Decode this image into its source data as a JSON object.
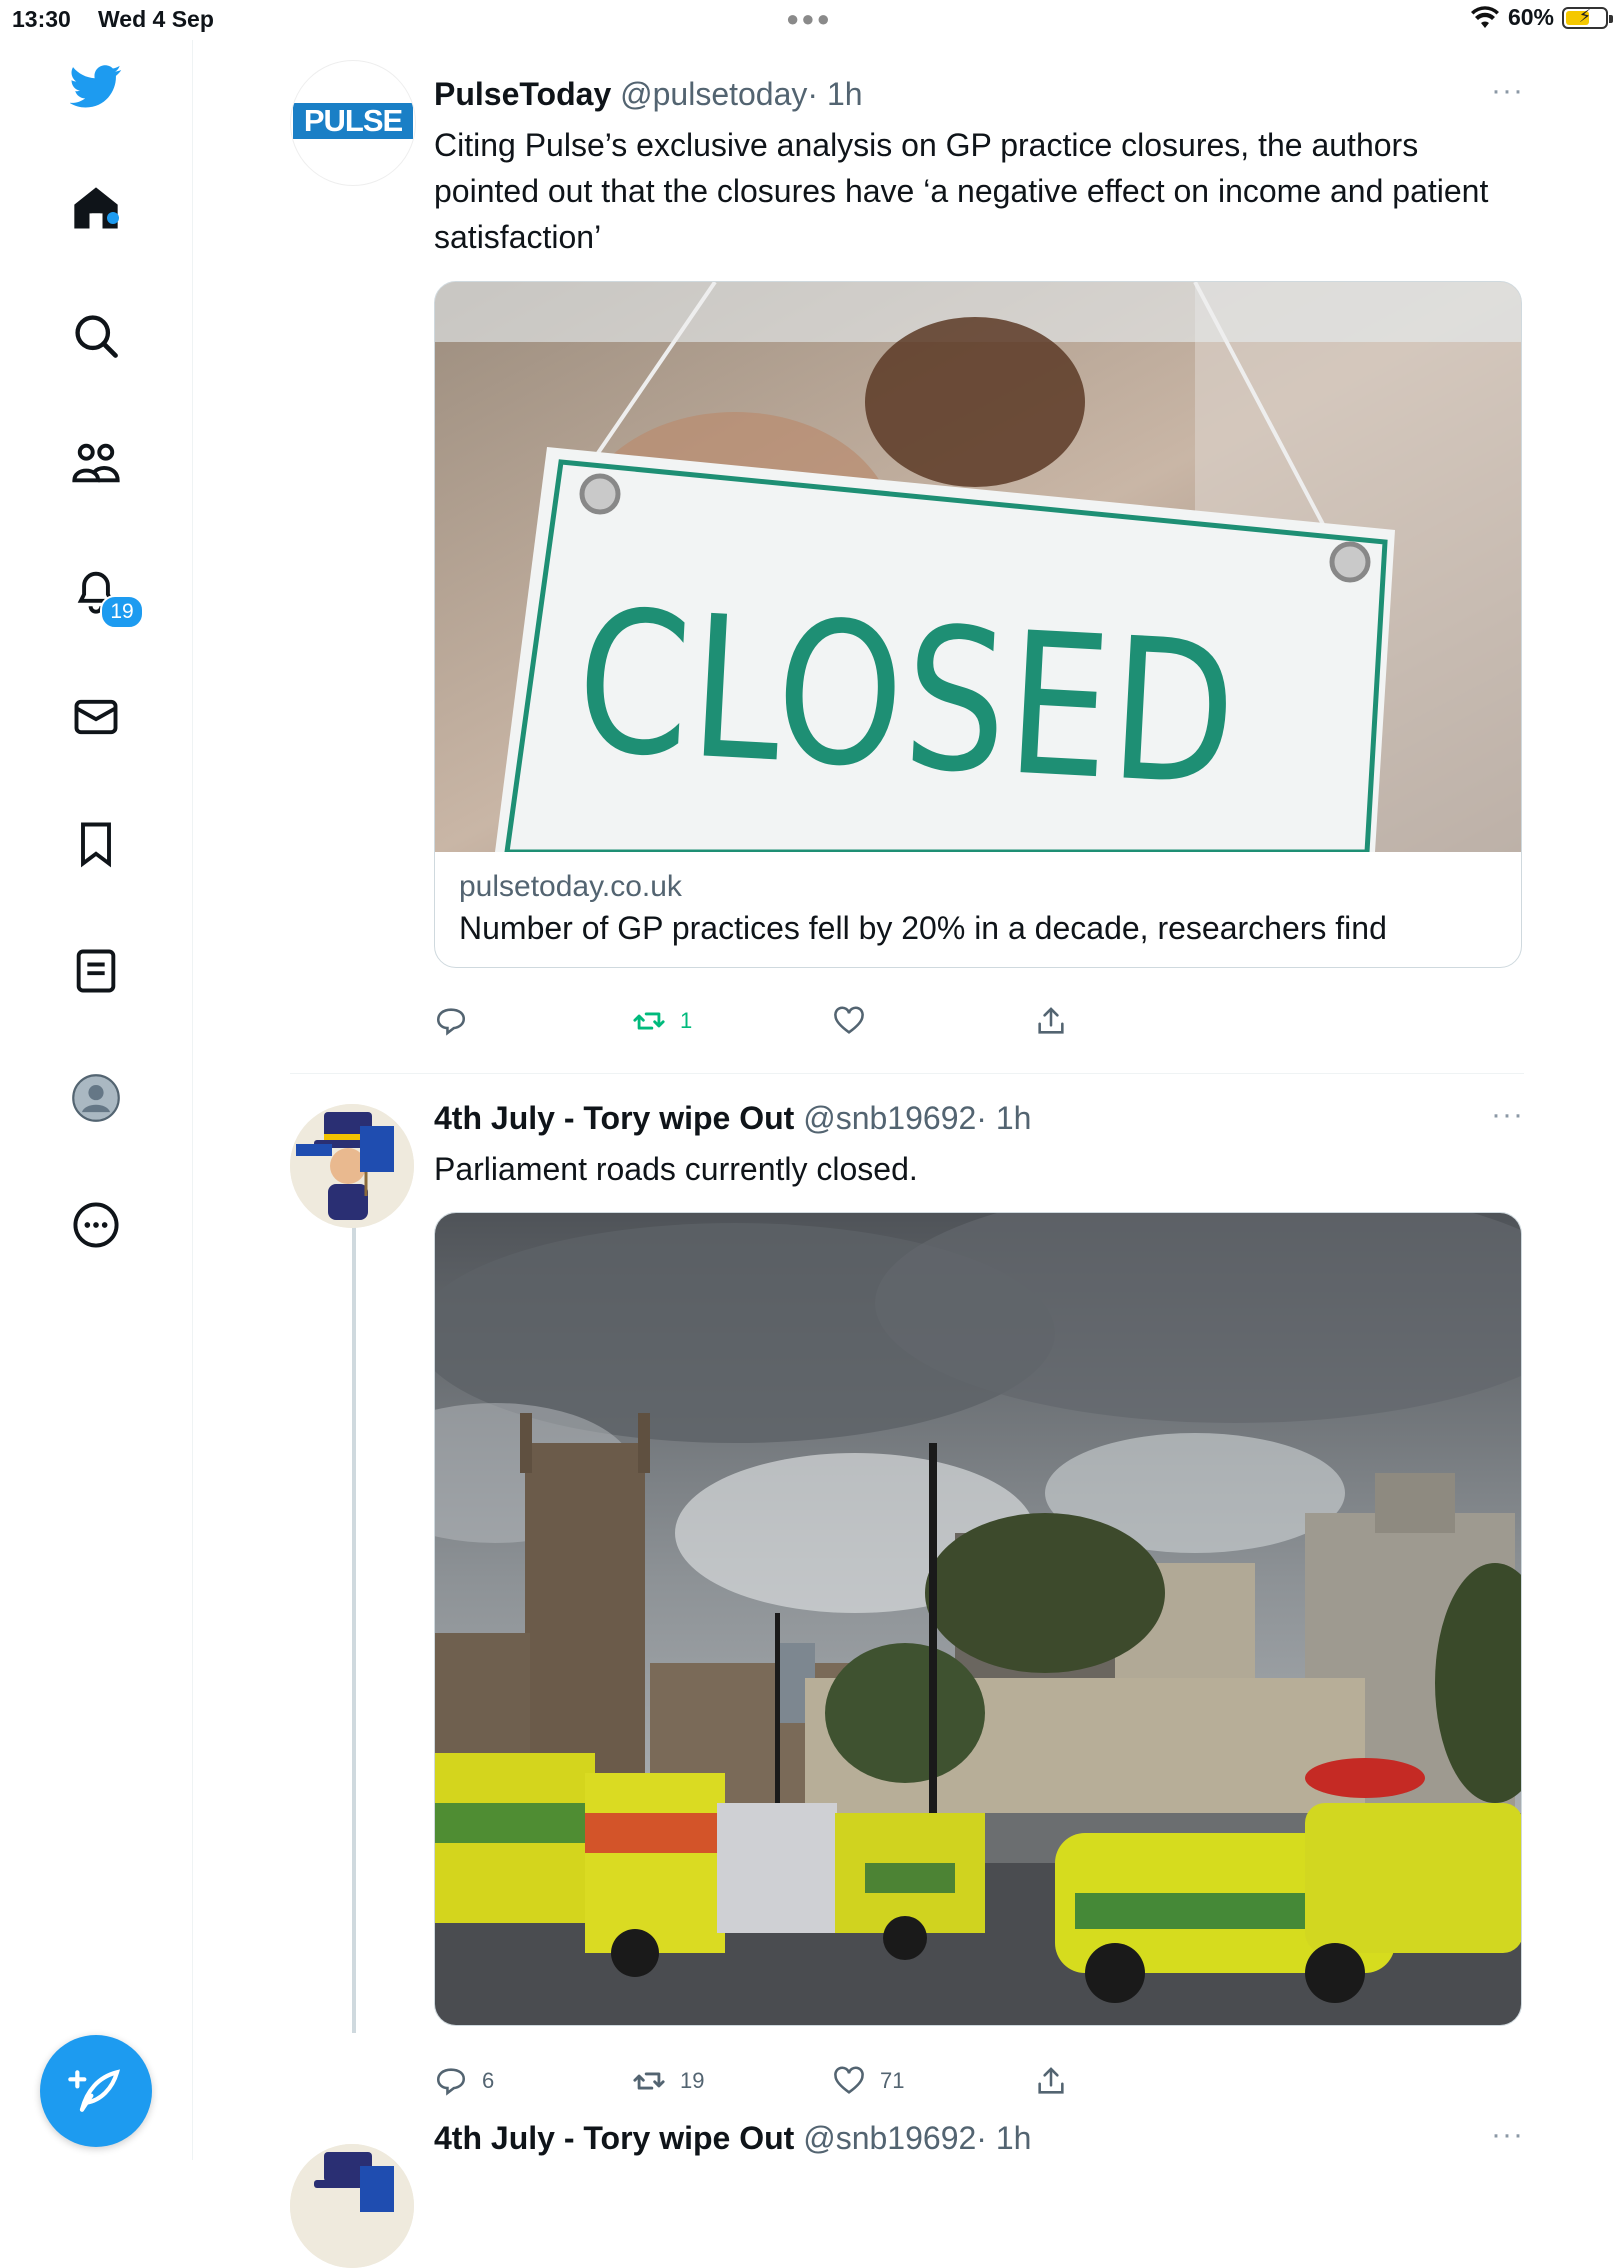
{
  "status_bar": {
    "time": "13:30",
    "date": "Wed 4 Sep",
    "battery": "60%",
    "battery_level": 0.6
  },
  "sidebar": {
    "items": [
      {
        "icon": "twitter-logo-icon"
      },
      {
        "icon": "home-icon"
      },
      {
        "icon": "search-icon"
      },
      {
        "icon": "communities-icon"
      },
      {
        "icon": "notifications-bell-icon",
        "badge": "19"
      },
      {
        "icon": "messages-envelope-icon"
      },
      {
        "icon": "bookmark-icon"
      },
      {
        "icon": "lists-icon"
      },
      {
        "icon": "profile-avatar-icon"
      },
      {
        "icon": "more-circle-icon"
      }
    ],
    "compose_icon": "compose-feather-icon"
  },
  "colors": {
    "accent": "#1d9bf0",
    "retweet_active": "#00ba7c",
    "secondary_text": "#536471"
  },
  "tweets": [
    {
      "name": "PulseToday",
      "handle": "@pulsetoday",
      "time": "· 1h",
      "more": "···",
      "avatar_logo": "PULSE",
      "text": "Citing Pulse’s exclusive analysis on GP practice closures, the authors pointed out that the closures have ‘a negative effect on income and patient satisfaction’",
      "media_sign_text": "CLOSED",
      "card": {
        "domain": "pulsetoday.co.uk",
        "title": "Number of GP practices fell by 20% in a decade, researchers find"
      },
      "replies": "",
      "retweets": "1",
      "likes": ""
    },
    {
      "name": "4th July - Tory wipe Out",
      "handle": "@snb19692",
      "time": "· 1h",
      "more": "···",
      "text": "Parliament roads currently closed.",
      "replies": "6",
      "retweets": "19",
      "likes": "71"
    },
    {
      "name": "4th July - Tory wipe Out",
      "handle": "@snb19692",
      "time": "· 1h",
      "more": "···"
    }
  ]
}
